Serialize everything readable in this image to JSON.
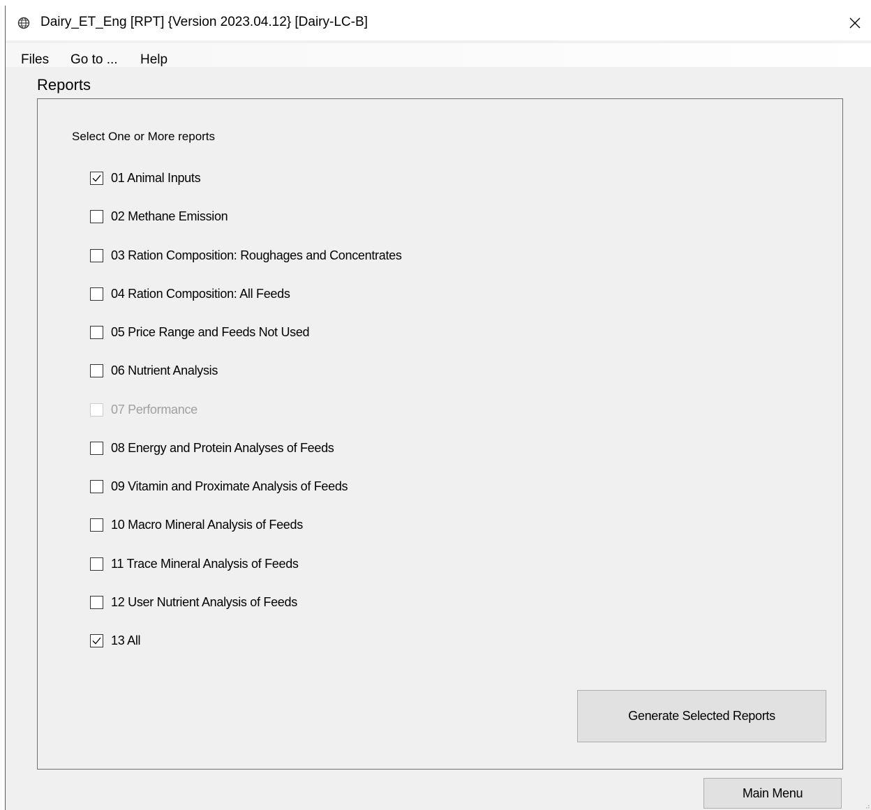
{
  "window": {
    "title": "Dairy_ET_Eng [RPT] {Version 2023.04.12}  [Dairy-LC-B]",
    "icon": "globe-icon",
    "close_glyph": "✕"
  },
  "menu": {
    "files": "Files",
    "goto": "Go to ...",
    "help": "Help"
  },
  "reports": {
    "group_label": "Reports",
    "instruction": "Select One or More reports",
    "items": [
      {
        "label": "01 Animal Inputs",
        "checked": true,
        "enabled": true
      },
      {
        "label": "02 Methane Emission",
        "checked": false,
        "enabled": true
      },
      {
        "label": "03 Ration Composition: Roughages and Concentrates",
        "checked": false,
        "enabled": true
      },
      {
        "label": "04 Ration Composition: All Feeds",
        "checked": false,
        "enabled": true
      },
      {
        "label": "05 Price Range and Feeds Not Used",
        "checked": false,
        "enabled": true
      },
      {
        "label": "06 Nutrient Analysis",
        "checked": false,
        "enabled": true
      },
      {
        "label": "07 Performance",
        "checked": false,
        "enabled": false
      },
      {
        "label": "08 Energy and Protein Analyses of Feeds",
        "checked": false,
        "enabled": true
      },
      {
        "label": "09 Vitamin and Proximate Analysis of Feeds",
        "checked": false,
        "enabled": true
      },
      {
        "label": "10 Macro Mineral Analysis of Feeds",
        "checked": false,
        "enabled": true
      },
      {
        "label": "11 Trace Mineral Analysis of Feeds",
        "checked": false,
        "enabled": true
      },
      {
        "label": "12 User Nutrient Analysis of Feeds",
        "checked": false,
        "enabled": true
      },
      {
        "label": "13 All",
        "checked": true,
        "enabled": true
      }
    ],
    "generate_button": "Generate Selected Reports"
  },
  "footer": {
    "main_menu_button": "Main Menu"
  }
}
